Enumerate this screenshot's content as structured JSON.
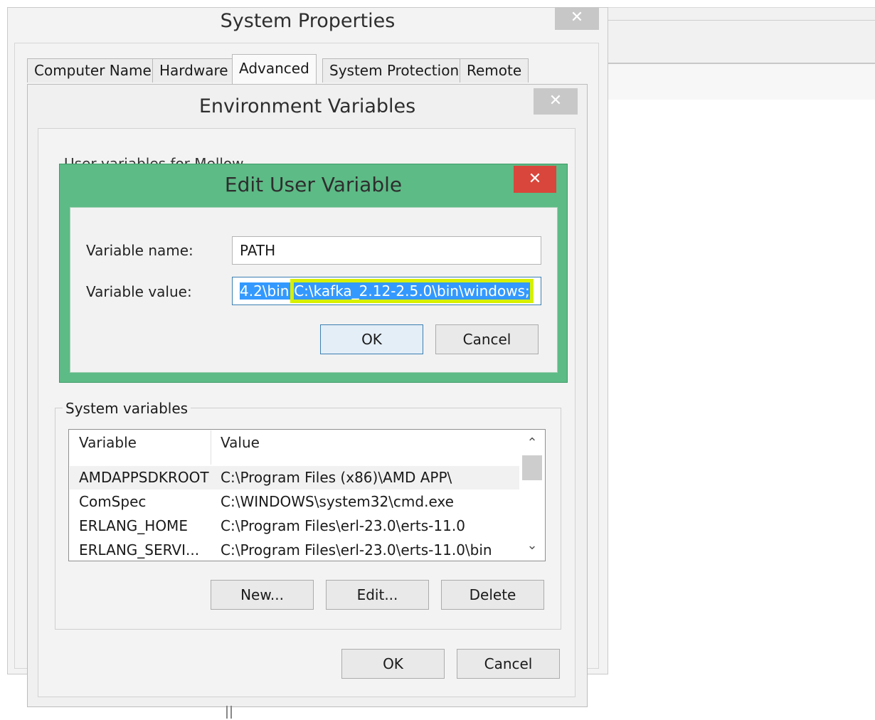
{
  "system_properties": {
    "title": "System Properties",
    "close_glyph": "✕",
    "tabs": [
      {
        "label": "Computer Name",
        "active": false
      },
      {
        "label": "Hardware",
        "active": false
      },
      {
        "label": "Advanced",
        "active": true
      },
      {
        "label": "System Protection",
        "active": false
      },
      {
        "label": "Remote",
        "active": false
      }
    ]
  },
  "environment_variables": {
    "title": "Environment Variables",
    "close_glyph": "✕",
    "user_variables_label": "User variables for Mellow",
    "system_variables_label": "System variables",
    "columns": [
      "Variable",
      "Value"
    ],
    "rows": [
      {
        "variable": "AMDAPPSDKROOT",
        "value": "C:\\Program Files (x86)\\AMD APP\\"
      },
      {
        "variable": "ComSpec",
        "value": "C:\\WINDOWS\\system32\\cmd.exe"
      },
      {
        "variable": "ERLANG_HOME",
        "value": "C:\\Program Files\\erl-23.0\\erts-11.0"
      },
      {
        "variable": "ERLANG_SERVI...",
        "value": "C:\\Program Files\\erl-23.0\\erts-11.0\\bin"
      }
    ],
    "buttons": {
      "new": "New...",
      "edit": "Edit...",
      "delete": "Delete",
      "ok": "OK",
      "cancel": "Cancel"
    },
    "scroll_up_glyph": "⌃",
    "scroll_down_glyph": "⌄"
  },
  "edit_user_variable": {
    "title": "Edit User Variable",
    "close_glyph": "✕",
    "name_label": "Variable name:",
    "value_label": "Variable value:",
    "name_value": "PATH",
    "value_prefix": "4.2\\bin;",
    "value_highlight": "C:\\kafka_2.12-2.5.0\\bin\\windows;",
    "ok_label": "OK",
    "cancel_label": "Cancel"
  },
  "colors": {
    "dialog_frame": "#5dbb86",
    "close_red": "#d9463b",
    "selection_blue": "#3399ff",
    "highlighter_yellow": "#d6f000"
  }
}
